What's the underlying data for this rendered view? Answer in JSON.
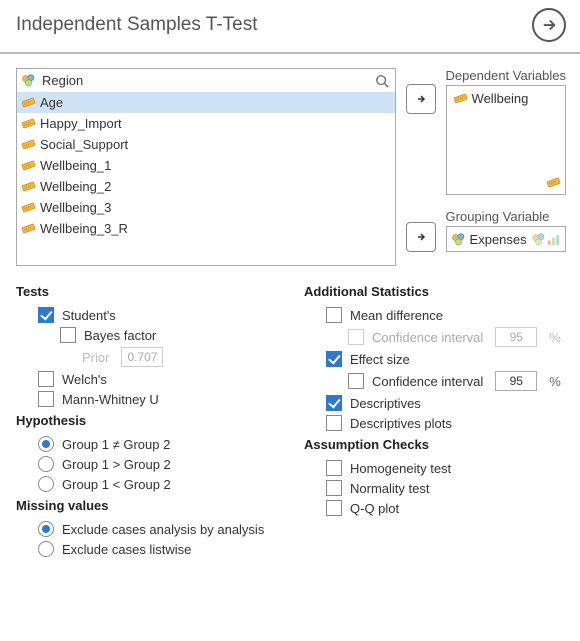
{
  "header": {
    "title": "Independent Samples T-Test"
  },
  "search": {
    "top_item": "Region"
  },
  "available_vars": [
    {
      "name": "Age",
      "selected": true
    },
    {
      "name": "Happy_Import",
      "selected": false
    },
    {
      "name": "Social_Support",
      "selected": false
    },
    {
      "name": "Wellbeing_1",
      "selected": false
    },
    {
      "name": "Wellbeing_2",
      "selected": false
    },
    {
      "name": "Wellbeing_3",
      "selected": false
    },
    {
      "name": "Wellbeing_3_R",
      "selected": false
    }
  ],
  "fields": {
    "dependent_label": "Dependent Variables",
    "dependent_items": [
      {
        "name": "Wellbeing"
      }
    ],
    "grouping_label": "Grouping Variable",
    "grouping_item": "Expenses"
  },
  "tests": {
    "title": "Tests",
    "students": "Student's",
    "bayes": "Bayes factor",
    "prior_label": "Prior",
    "prior_value": "0.707",
    "welchs": "Welch's",
    "mannwhitney": "Mann-Whitney U"
  },
  "hypothesis": {
    "title": "Hypothesis",
    "h1": "Group 1 ≠ Group 2",
    "h2": "Group 1 > Group 2",
    "h3": "Group 1 < Group 2"
  },
  "missing": {
    "title": "Missing values",
    "m1": "Exclude cases analysis by analysis",
    "m2": "Exclude cases listwise"
  },
  "addstats": {
    "title": "Additional Statistics",
    "meandiff": "Mean difference",
    "ci": "Confidence interval",
    "ci_val": "95",
    "pct": "%",
    "effectsize": "Effect size",
    "desc": "Descriptives",
    "descplots": "Descriptives plots"
  },
  "assumption": {
    "title": "Assumption Checks",
    "homog": "Homogeneity test",
    "normal": "Normality test",
    "qq": "Q-Q plot"
  }
}
